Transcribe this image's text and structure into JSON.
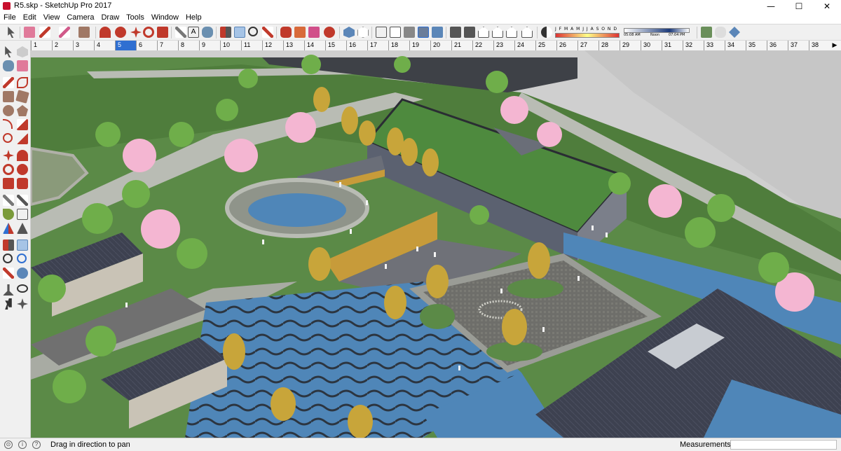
{
  "window": {
    "title": "R5.skp - SketchUp Pro 2017",
    "minimize_glyph": "—",
    "maximize_glyph": "☐",
    "close_glyph": "✕"
  },
  "menu": [
    "File",
    "Edit",
    "View",
    "Camera",
    "Draw",
    "Tools",
    "Window",
    "Help"
  ],
  "shadow": {
    "months": "J F M A M J J A S O N D",
    "time_start": "05:08 AM",
    "time_noon": "Noon",
    "time_end": "07:04 PM"
  },
  "ruler": {
    "labels": [
      "1",
      "2",
      "3",
      "4",
      "5",
      "6",
      "7",
      "8",
      "9",
      "10",
      "11",
      "12",
      "13",
      "14",
      "15",
      "16",
      "17",
      "18",
      "19",
      "20",
      "21",
      "22",
      "23",
      "24",
      "25",
      "26",
      "27",
      "28",
      "29",
      "30",
      "31",
      "32",
      "33",
      "34",
      "35",
      "36",
      "37",
      "38"
    ],
    "active": "5",
    "scroll_glyph": "▶"
  },
  "status": {
    "hint": "Drag in direction to pan",
    "measurements_label": "Measurements",
    "measurements_value": ""
  },
  "colors": {
    "grass": "#5b8a47",
    "path": "#b9bcb4",
    "water": "#4f86b8",
    "roof": "#3d4150",
    "ground": "#6e6f66",
    "accent_tab": "#2f6fd1",
    "sky": "#ffffff"
  },
  "icons": {
    "status_icons": [
      "geo-location-icon",
      "credits-icon",
      "help-icon"
    ]
  }
}
